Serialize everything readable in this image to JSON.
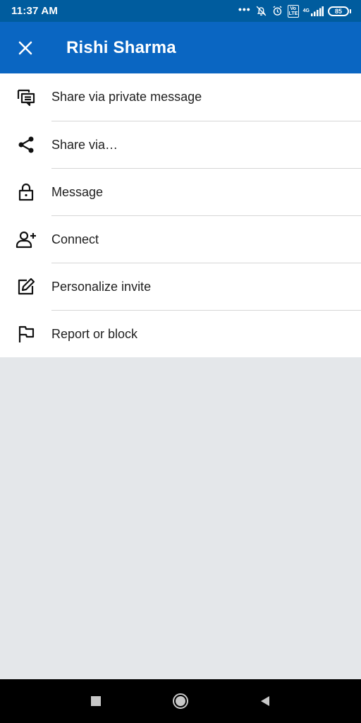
{
  "status_bar": {
    "time": "11:37 AM",
    "overflow": "•••",
    "volte_label": "Vo LTE",
    "network_label": "4G",
    "battery_level": "85"
  },
  "header": {
    "title": "Rishi Sharma",
    "close_icon": "close-icon"
  },
  "menu": {
    "items": [
      {
        "label": "Share via private message",
        "icon": "chat-bubbles-icon"
      },
      {
        "label": "Share via…",
        "icon": "share-icon"
      },
      {
        "label": "Message",
        "icon": "lock-icon"
      },
      {
        "label": "Connect",
        "icon": "add-person-icon"
      },
      {
        "label": "Personalize invite",
        "icon": "edit-icon"
      },
      {
        "label": "Report or block",
        "icon": "flag-icon"
      }
    ]
  },
  "colors": {
    "status_bar": "#005c9e",
    "app_bar": "#0a66c2",
    "background": "#e4e7ea"
  },
  "nav_bar": {
    "buttons": [
      "recents-icon",
      "home-icon",
      "back-icon"
    ]
  }
}
